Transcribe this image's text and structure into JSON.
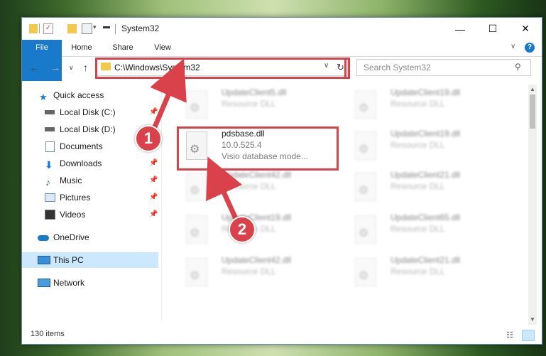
{
  "window": {
    "title": "System32",
    "controls": {
      "minimize": "—",
      "maximize": "☐",
      "close": "✕"
    }
  },
  "ribbon": {
    "tabs": [
      "File",
      "Home",
      "Share",
      "View"
    ],
    "help": "?"
  },
  "address": {
    "path": "C:\\Windows\\System32",
    "search_placeholder": "Search System32"
  },
  "sidebar": {
    "items": [
      {
        "label": "Quick access",
        "icon": "star-icon",
        "pinned": false
      },
      {
        "label": "Local Disk (C:)",
        "icon": "drive-icon",
        "pinned": true
      },
      {
        "label": "Local Disk (D:)",
        "icon": "drive-icon",
        "pinned": false
      },
      {
        "label": "Documents",
        "icon": "document-icon",
        "pinned": true
      },
      {
        "label": "Downloads",
        "icon": "download-icon",
        "pinned": true
      },
      {
        "label": "Music",
        "icon": "music-icon",
        "pinned": true
      },
      {
        "label": "Pictures",
        "icon": "pictures-icon",
        "pinned": true
      },
      {
        "label": "Videos",
        "icon": "videos-icon",
        "pinned": true
      },
      {
        "label": "OneDrive",
        "icon": "cloud-icon",
        "pinned": false
      },
      {
        "label": "This PC",
        "icon": "computer-icon",
        "pinned": false,
        "selected": true
      },
      {
        "label": "Network",
        "icon": "network-icon",
        "pinned": false
      }
    ]
  },
  "files": [
    {
      "name": "UpdateClient5.dll",
      "meta1": "Resource DLL",
      "meta2": "",
      "blurred": true
    },
    {
      "name": "UpdateClient19.dll",
      "meta1": "Resource DLL",
      "meta2": "",
      "blurred": true
    },
    {
      "name": "pdsbase.dll",
      "meta1": "10.0.525.4",
      "meta2": "Visio database mode...",
      "blurred": false
    },
    {
      "name": "UpdateClient19.dll",
      "meta1": "Resource DLL",
      "meta2": "",
      "blurred": true
    },
    {
      "name": "UpdateClient42.dll",
      "meta1": "Resource DLL",
      "meta2": "",
      "blurred": true
    },
    {
      "name": "UpdateClient21.dll",
      "meta1": "Resource DLL",
      "meta2": "",
      "blurred": true
    },
    {
      "name": "UpdateClient19.dll",
      "meta1": "Resource DLL",
      "meta2": "",
      "blurred": true
    },
    {
      "name": "UpdateClient65.dll",
      "meta1": "Resource DLL",
      "meta2": "",
      "blurred": true
    },
    {
      "name": "UpdateClient42.dll",
      "meta1": "Resource DLL",
      "meta2": "",
      "blurred": true
    },
    {
      "name": "UpdateClient21.dll",
      "meta1": "Resource DLL",
      "meta2": "",
      "blurred": true
    }
  ],
  "status": {
    "item_count": "130 items"
  },
  "annotations": {
    "badge1": "1",
    "badge2": "2",
    "color": "#d9414b"
  },
  "colors": {
    "accent": "#1979ca",
    "selection": "#cce8ff",
    "highlight": "#d9414b"
  }
}
